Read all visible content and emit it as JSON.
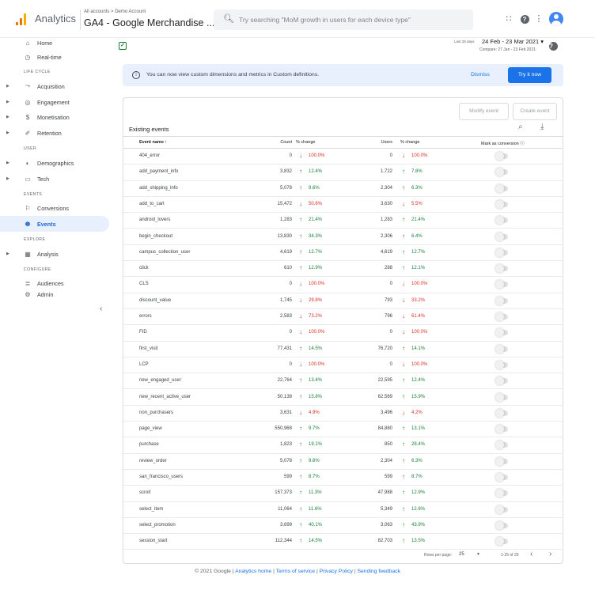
{
  "header": {
    "app_name": "Analytics",
    "breadcrumb": "All accounts > Demo Account",
    "property": "GA4 - Google Merchandise ...",
    "property_caret": "▾",
    "search_placeholder": "Try searching \"MoM growth in users for each device type\""
  },
  "sidebar": {
    "items": [
      {
        "label": "Home",
        "icon": "home-icon",
        "glyph": "⌂",
        "top": 0
      },
      {
        "label": "Real-time",
        "icon": "clock-icon",
        "glyph": "◷"
      }
    ],
    "home": "Home",
    "realtime": "Real-time",
    "section_lifecycle": "LIFE CYCLE",
    "acquisition": "Acquisition",
    "engagement": "Engagement",
    "monetisation": "Monetisation",
    "retention": "Retention",
    "section_user": "USER",
    "demographics": "Demographics",
    "tech": "Tech",
    "section_events": "EVENTS",
    "conversions": "Conversions",
    "events": "Events",
    "section_explore": "EXPLORE",
    "analysis": "Analysis",
    "section_configure": "CONFIGURE",
    "audiences": "Audiences",
    "admin": "Admin",
    "collapse": "‹"
  },
  "date": {
    "last_label": "Last 28 days",
    "range": "24 Feb - 23 Mar 2021",
    "caret": "▾",
    "compare": "Compare: 27 Jan - 23 Feb 2021"
  },
  "banner": {
    "text": "You can now view custom dimensions and metrics in Custom definitions.",
    "dismiss": "Dismiss",
    "try_it": "Try it now"
  },
  "card": {
    "modify": "Modify event",
    "create": "Create event",
    "title": "Existing events"
  },
  "table": {
    "headers": {
      "name": "Event name ↑",
      "count": "Count",
      "count_change": "% change",
      "users": "Users",
      "users_change": "% change",
      "mark": "Mark as conversion ⓘ"
    },
    "rows": [
      {
        "name": "404_error",
        "count": "0",
        "cdir": "down",
        "cpct": "100.0%",
        "users": "0",
        "udir": "down",
        "upct": "100.0%"
      },
      {
        "name": "add_payment_info",
        "count": "3,832",
        "cdir": "up",
        "cpct": "12.4%",
        "users": "1,722",
        "udir": "up",
        "upct": "7.8%"
      },
      {
        "name": "add_shipping_info",
        "count": "5,078",
        "cdir": "up",
        "cpct": "9.6%",
        "users": "2,304",
        "udir": "up",
        "upct": "6.3%"
      },
      {
        "name": "add_to_cart",
        "count": "15,472",
        "cdir": "down",
        "cpct": "50.6%",
        "users": "3,630",
        "udir": "down",
        "upct": "5.5%"
      },
      {
        "name": "android_lovers",
        "count": "1,283",
        "cdir": "up",
        "cpct": "21.4%",
        "users": "1,283",
        "udir": "up",
        "upct": "21.4%"
      },
      {
        "name": "begin_checkout",
        "count": "13,830",
        "cdir": "up",
        "cpct": "34.3%",
        "users": "2,306",
        "udir": "up",
        "upct": "6.4%"
      },
      {
        "name": "campus_collection_user",
        "count": "4,619",
        "cdir": "up",
        "cpct": "12.7%",
        "users": "4,619",
        "udir": "up",
        "upct": "12.7%"
      },
      {
        "name": "click",
        "count": "610",
        "cdir": "up",
        "cpct": "12.9%",
        "users": "288",
        "udir": "up",
        "upct": "12.1%"
      },
      {
        "name": "CLS",
        "count": "0",
        "cdir": "down",
        "cpct": "100.0%",
        "users": "0",
        "udir": "down",
        "upct": "100.0%"
      },
      {
        "name": "discount_value",
        "count": "1,745",
        "cdir": "down",
        "cpct": "29.8%",
        "users": "793",
        "udir": "down",
        "upct": "33.2%"
      },
      {
        "name": "errors",
        "count": "2,583",
        "cdir": "down",
        "cpct": "73.2%",
        "users": "796",
        "udir": "down",
        "upct": "61.4%"
      },
      {
        "name": "FID",
        "count": "0",
        "cdir": "down",
        "cpct": "100.0%",
        "users": "0",
        "udir": "down",
        "upct": "100.0%"
      },
      {
        "name": "first_visit",
        "count": "77,431",
        "cdir": "up",
        "cpct": "14.5%",
        "users": "76,720",
        "udir": "up",
        "upct": "14.1%"
      },
      {
        "name": "LCP",
        "count": "0",
        "cdir": "down",
        "cpct": "100.0%",
        "users": "0",
        "udir": "down",
        "upct": "100.0%"
      },
      {
        "name": "new_engaged_user",
        "count": "22,764",
        "cdir": "up",
        "cpct": "13.4%",
        "users": "22,595",
        "udir": "up",
        "upct": "12.4%"
      },
      {
        "name": "new_recent_active_user",
        "count": "50,138",
        "cdir": "up",
        "cpct": "15.8%",
        "users": "62,569",
        "udir": "up",
        "upct": "15.9%"
      },
      {
        "name": "non_purchasers",
        "count": "3,631",
        "cdir": "down",
        "cpct": "4.9%",
        "users": "3,496",
        "udir": "down",
        "upct": "4.2%"
      },
      {
        "name": "page_view",
        "count": "550,968",
        "cdir": "up",
        "cpct": "9.7%",
        "users": "84,880",
        "udir": "up",
        "upct": "13.1%"
      },
      {
        "name": "purchase",
        "count": "1,823",
        "cdir": "up",
        "cpct": "19.1%",
        "users": "850",
        "udir": "up",
        "upct": "28.4%"
      },
      {
        "name": "review_order",
        "count": "5,078",
        "cdir": "up",
        "cpct": "9.6%",
        "users": "2,304",
        "udir": "up",
        "upct": "6.3%"
      },
      {
        "name": "san_francisco_users",
        "count": "599",
        "cdir": "up",
        "cpct": "8.7%",
        "users": "599",
        "udir": "up",
        "upct": "8.7%"
      },
      {
        "name": "scroll",
        "count": "157,373",
        "cdir": "up",
        "cpct": "11.3%",
        "users": "47,988",
        "udir": "up",
        "upct": "12.9%"
      },
      {
        "name": "select_item",
        "count": "11,064",
        "cdir": "up",
        "cpct": "11.6%",
        "users": "5,349",
        "udir": "up",
        "upct": "12.6%"
      },
      {
        "name": "select_promotion",
        "count": "3,699",
        "cdir": "up",
        "cpct": "40.1%",
        "users": "3,063",
        "udir": "up",
        "upct": "43.9%"
      },
      {
        "name": "session_start",
        "count": "112,344",
        "cdir": "up",
        "cpct": "14.5%",
        "users": "82,703",
        "udir": "up",
        "upct": "13.5%"
      }
    ]
  },
  "pager": {
    "rows_per_page_label": "Rows per page:",
    "rows_per_page": "25",
    "range": "1-25 of 29"
  },
  "footer": {
    "copyright": "© 2021 Google |",
    "home": "Analytics home",
    "sep1": "|",
    "terms": "Terms of service",
    "sep2": "|",
    "privacy": "Privacy Policy",
    "sep3": "|",
    "feedback": "Sending feedback"
  },
  "colors": {
    "accent": "#1a73e8",
    "up": "#188038",
    "down": "#d93025",
    "active_bg": "#e8f0fe"
  }
}
